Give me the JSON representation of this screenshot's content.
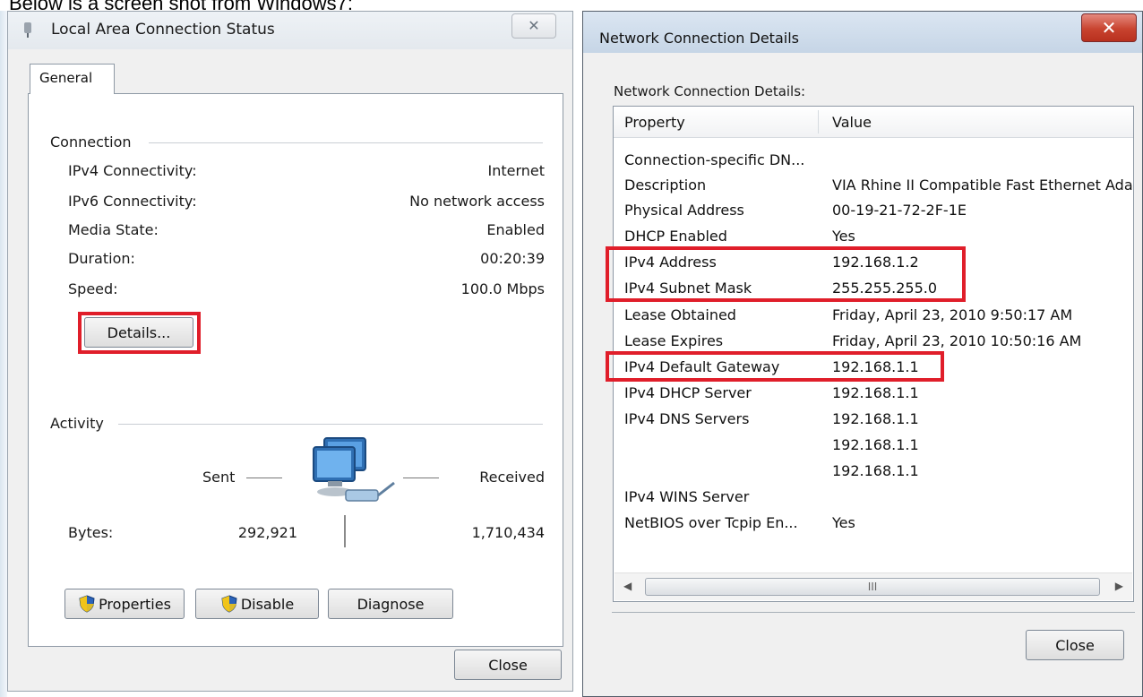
{
  "caption": "Below is a screen shot from Windows7:",
  "background_strip": "Local Area Connection ... VIA Rhine II Compatible Fast Ethe...",
  "left": {
    "title": "Local Area Connection Status",
    "tab": "General",
    "connection": {
      "heading": "Connection",
      "rows": [
        {
          "label": "IPv4 Connectivity:",
          "value": "Internet"
        },
        {
          "label": "IPv6 Connectivity:",
          "value": "No network access"
        },
        {
          "label": "Media State:",
          "value": "Enabled"
        },
        {
          "label": "Duration:",
          "value": "00:20:39"
        },
        {
          "label": "Speed:",
          "value": "100.0 Mbps"
        }
      ],
      "details_button": "Details..."
    },
    "activity": {
      "heading": "Activity",
      "sent": "Sent",
      "received": "Received",
      "bytes_label": "Bytes:",
      "bytes_sent": "292,921",
      "bytes_received": "1,710,434"
    },
    "buttons": {
      "properties": "Properties",
      "disable": "Disable",
      "diagnose": "Diagnose",
      "close": "Close"
    }
  },
  "right": {
    "title": "Network Connection Details",
    "group_label": "Network Connection Details:",
    "columns": {
      "property": "Property",
      "value": "Value"
    },
    "rows": [
      {
        "property": "Connection-specific DN...",
        "value": ""
      },
      {
        "property": "Description",
        "value": "VIA Rhine II Compatible Fast Ethernet Ada"
      },
      {
        "property": "Physical Address",
        "value": "00-19-21-72-2F-1E"
      },
      {
        "property": "DHCP Enabled",
        "value": "Yes"
      },
      {
        "property": "IPv4 Address",
        "value": "192.168.1.2"
      },
      {
        "property": "IPv4 Subnet Mask",
        "value": "255.255.255.0"
      },
      {
        "property": "Lease Obtained",
        "value": "Friday, April 23, 2010 9:50:17 AM"
      },
      {
        "property": "Lease Expires",
        "value": "Friday, April 23, 2010 10:50:16 AM"
      },
      {
        "property": "IPv4 Default Gateway",
        "value": "192.168.1.1"
      },
      {
        "property": "IPv4 DHCP Server",
        "value": "192.168.1.1"
      },
      {
        "property": "IPv4 DNS Servers",
        "value": "192.168.1.1"
      },
      {
        "property": "",
        "value": "192.168.1.1"
      },
      {
        "property": "",
        "value": "192.168.1.1"
      },
      {
        "property": "IPv4 WINS Server",
        "value": ""
      },
      {
        "property": "NetBIOS over Tcpip En...",
        "value": "Yes"
      }
    ],
    "scroll_thumb": "III",
    "close_button": "Close"
  },
  "colors": {
    "highlight_box": "#e01e2a",
    "close_red": "#c8432f"
  }
}
